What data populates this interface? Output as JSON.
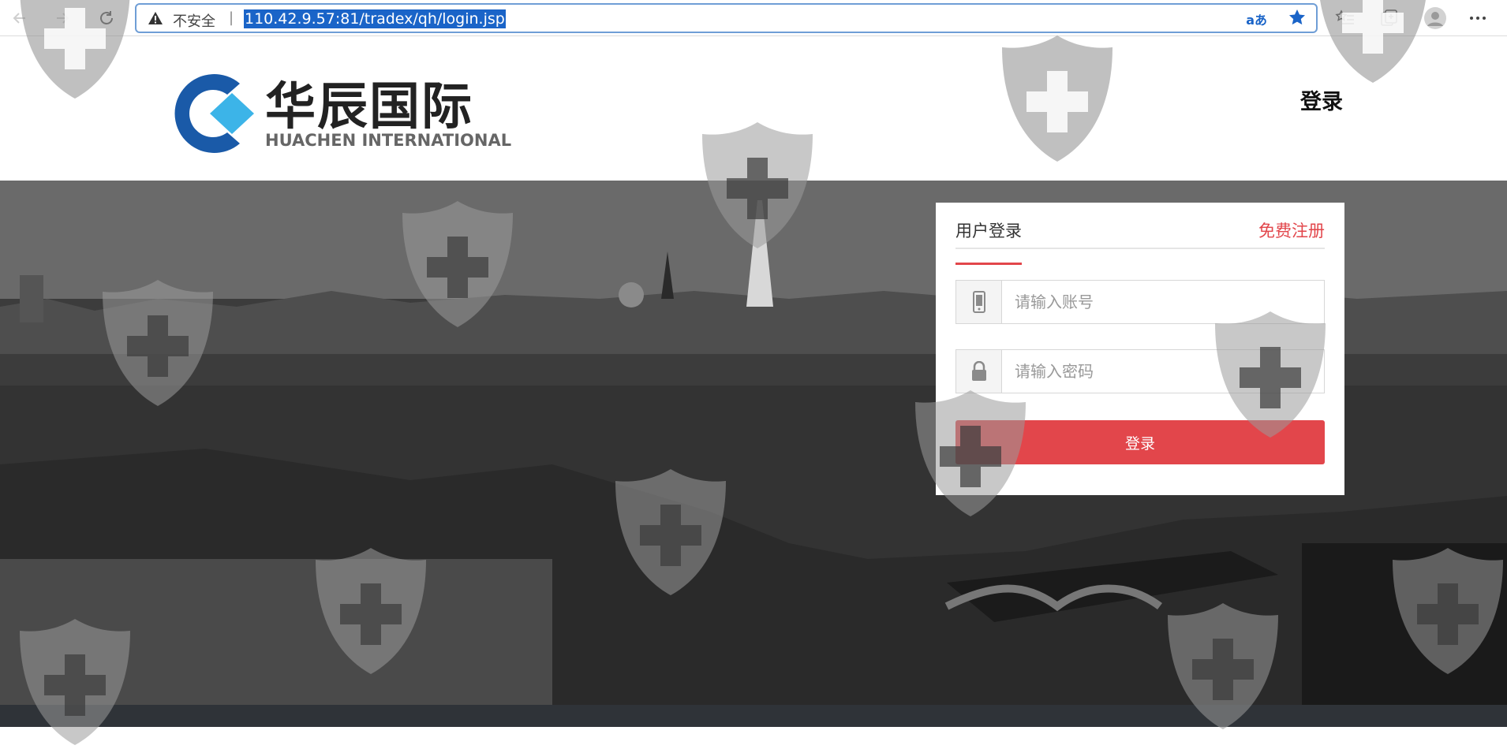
{
  "browser": {
    "security_label": "不安全",
    "separator": "|",
    "url": "110.42.9.57:81/tradex/qh/login.jsp",
    "read_aloud_glyph": "aあ"
  },
  "header": {
    "brand_cn": "华辰国际",
    "brand_en": "HUACHEN INTERNATIONAL",
    "login_link": "登录"
  },
  "login_panel": {
    "tab_label": "用户登录",
    "register_label": "免费注册",
    "account_placeholder": "请输入账号",
    "password_placeholder": "请输入密码",
    "submit_label": "登录"
  },
  "colors": {
    "accent": "#e2464b",
    "logo_blue": "#1a5aa8",
    "logo_cyan": "#3cb4e8",
    "footer": "#2f3338"
  },
  "icons": [
    "back-icon",
    "forward-icon",
    "refresh-icon",
    "warning-icon",
    "read-aloud-icon",
    "favorite-star-icon",
    "favorites-list-icon",
    "collections-icon",
    "profile-avatar-icon",
    "more-options-icon",
    "phone-icon",
    "lock-icon",
    "shield-watermark-icon"
  ]
}
